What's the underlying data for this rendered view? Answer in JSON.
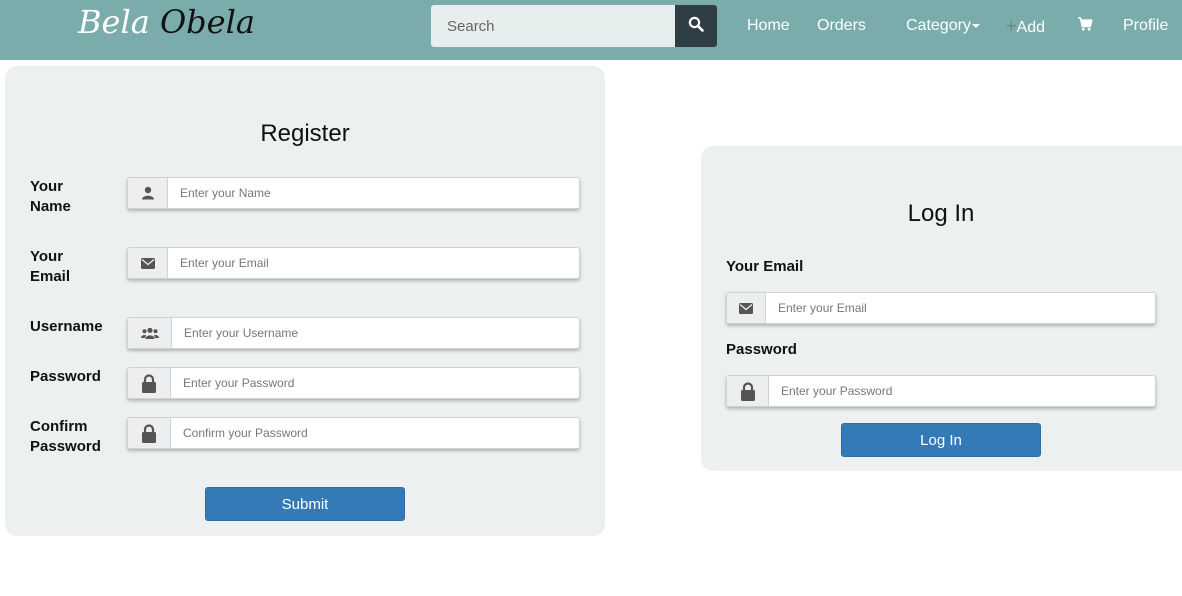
{
  "brand": {
    "part1": "Bela",
    "part2": "Obela"
  },
  "search": {
    "placeholder": "Search",
    "button_icon": "search-icon"
  },
  "nav": {
    "home": "Home",
    "orders": "Orders",
    "category": "Category",
    "add_plus": "+",
    "add": "Add",
    "cart_icon": "cart-icon",
    "profile": "Profile"
  },
  "register": {
    "title": "Register",
    "fields": [
      {
        "label_line1": "Your",
        "label_line2": "Name",
        "placeholder": "Enter your Name",
        "icon": "user-icon"
      },
      {
        "label_line1": "Your",
        "label_line2": "Email",
        "placeholder": "Enter your Email",
        "icon": "envelope-icon"
      },
      {
        "label_line1": "Username",
        "label_line2": "",
        "placeholder": "Enter your Username",
        "icon": "users-icon"
      },
      {
        "label_line1": "Password",
        "label_line2": "",
        "placeholder": "Enter your Password",
        "icon": "lock-icon"
      },
      {
        "label_line1": "Confirm",
        "label_line2": "Password",
        "placeholder": "Confirm your Password",
        "icon": "lock-icon"
      }
    ],
    "submit_label": "Submit"
  },
  "login": {
    "title": "Log In",
    "email_label": "Your Email",
    "email_placeholder": "Enter your Email",
    "password_label": "Password",
    "password_placeholder": "Enter your Password",
    "submit_label": "Log In"
  },
  "colors": {
    "navbar": "#7aacac",
    "search_button": "#2f3d44",
    "card_background": "#edf0f1",
    "primary_button": "#337ab7"
  }
}
